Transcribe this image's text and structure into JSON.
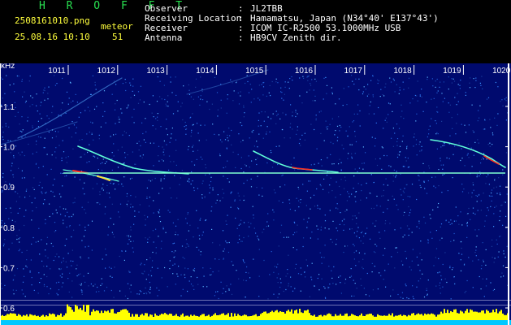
{
  "header": {
    "app_name": "H R O F F T",
    "filename": "2508161010.png",
    "datetime": "25.08.16 10:10",
    "meteor_label": "meteor",
    "meteor_count": "51",
    "station": [
      {
        "label": "Observer",
        "colon": ":",
        "value": "JL2TBB"
      },
      {
        "label": "Receiving Location",
        "colon": ":",
        "value": "Hamamatsu, Japan (N34°40' E137°43')"
      },
      {
        "label": "Receiver",
        "colon": ":",
        "value": "ICOM IC-R2500 53.1000MHz USB"
      },
      {
        "label": "Antenna",
        "colon": ":",
        "value": "HB9CV Zenith dir."
      }
    ]
  },
  "spectrogram": {
    "unit_label": "kHz",
    "time_ticks": [
      "1011",
      "1012",
      "1013",
      "1014",
      "1015",
      "1016",
      "1017",
      "1018",
      "1019",
      "1020"
    ],
    "freq_ticks": [
      "1.1",
      "1.0",
      "0.9",
      "0.8",
      "0.7",
      "0.6"
    ],
    "colors": {
      "background": "#000a6e",
      "carrier": "#7fffd0",
      "echo_hot": "#ff3020",
      "echo_warm": "#ffe040",
      "meter_fill": "#ffff00",
      "meter_base": "#00c8ff"
    }
  }
}
